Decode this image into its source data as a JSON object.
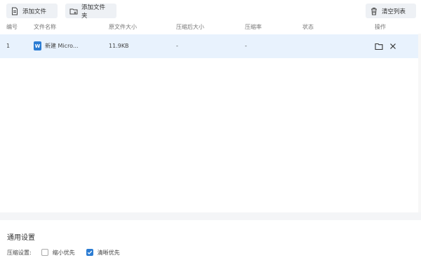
{
  "toolbar": {
    "add_file": "添加文件",
    "add_folder": "添加文件夹",
    "clear_list": "清空列表"
  },
  "table": {
    "columns": [
      "编号",
      "文件名称",
      "原文件大小",
      "压缩后大小",
      "压缩率",
      "状态",
      "操作"
    ],
    "rows": [
      {
        "index": "1",
        "icon": "word-file-icon",
        "icon_letter": "W",
        "name": "新建 Micro...",
        "original_size": "11.9KB",
        "compressed_size": "-",
        "rate": "-",
        "status": ""
      }
    ]
  },
  "settings": {
    "title": "通用设置",
    "compress_label": "压缩设置:",
    "options": [
      {
        "label": "缩小优先",
        "checked": false
      },
      {
        "label": "清晰优先",
        "checked": true
      }
    ]
  },
  "colors": {
    "accent": "#2b7cd3",
    "row_selected": "#e8f2fd",
    "button_bg": "#eef1f5"
  }
}
